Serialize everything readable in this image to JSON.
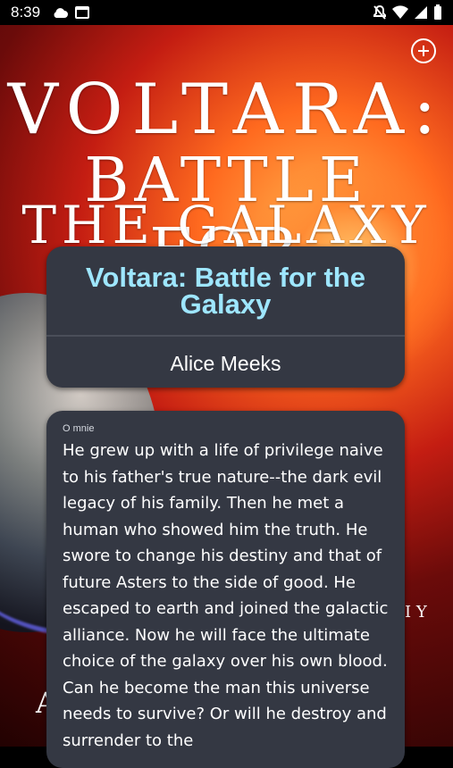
{
  "status_bar": {
    "time": "8:39"
  },
  "cover": {
    "title_line1": "VOLTARA:",
    "title_line2": "BATTLE FOR",
    "title_line3": "THE GALAXY",
    "left_letter": "A",
    "right_letters": "I Y"
  },
  "book": {
    "title": "Voltara: Battle for the Galaxy",
    "author": "Alice Meeks",
    "description_label": "O mnie",
    "description": "He grew up with a life of privilege naive to his father's true nature--the dark evil legacy of his family. Then he met a human who showed him the truth. He swore to change his destiny and that of future Asters to the side of good. He escaped to earth and joined the galactic alliance. Now he will face the ultimate choice of the galaxy over his own blood. Can he become the man this universe needs to survive? Or will he destroy and surrender to the"
  }
}
